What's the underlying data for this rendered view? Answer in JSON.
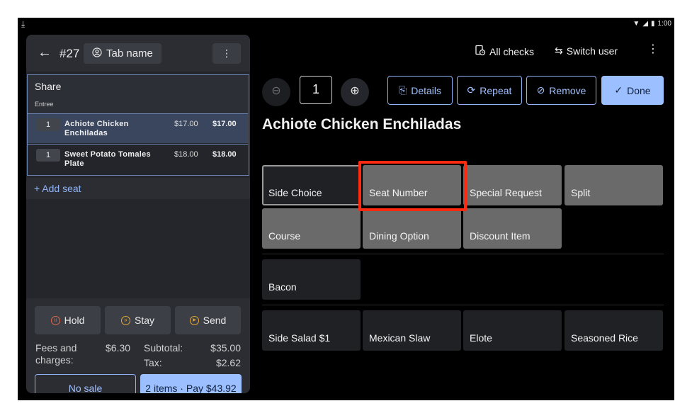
{
  "status": {
    "time": "1:00"
  },
  "left": {
    "tab_number": "#27",
    "tab_name_label": "Tab name",
    "share_title": "Share",
    "entree_label": "Entree",
    "items": [
      {
        "qty": "1",
        "name": "Achiote Chicken Enchiladas",
        "price": "$17.00",
        "total": "$17.00"
      },
      {
        "qty": "1",
        "name": "Sweet Potato Tomales Plate",
        "price": "$18.00",
        "total": "$18.00"
      }
    ],
    "add_seat": "+ Add seat",
    "hold": "Hold",
    "stay": "Stay",
    "send": "Send",
    "fees_label": "Fees and charges:",
    "fees_value": "$6.30",
    "subtotal_label": "Subtotal:",
    "subtotal_value": "$35.00",
    "tax_label": "Tax:",
    "tax_value": "$2.62",
    "no_sale": "No sale",
    "pay": "2 items · Pay $43.92"
  },
  "top": {
    "all_checks": "All checks",
    "switch_user": "Switch user"
  },
  "editor": {
    "quantity": "1",
    "details": "Details",
    "repeat": "Repeat",
    "remove": "Remove",
    "done": "Done",
    "item_title": "Achiote Chicken Enchiladas"
  },
  "tiles": {
    "side_choice": "Side Choice",
    "seat_number": "Seat Number",
    "special_request": "Special Request",
    "split": "Split",
    "course": "Course",
    "dining_option": "Dining Option",
    "discount_item": "Discount Item",
    "bacon": "Bacon",
    "side_salad": "Side Salad $1",
    "mexican_slaw": "Mexican Slaw",
    "elote": "Elote",
    "seasoned_rice": "Seasoned Rice"
  },
  "colors": {
    "accent": "#9cc0ff",
    "highlight": "#ff2a10",
    "tile_gray": "#6a6a6a"
  }
}
